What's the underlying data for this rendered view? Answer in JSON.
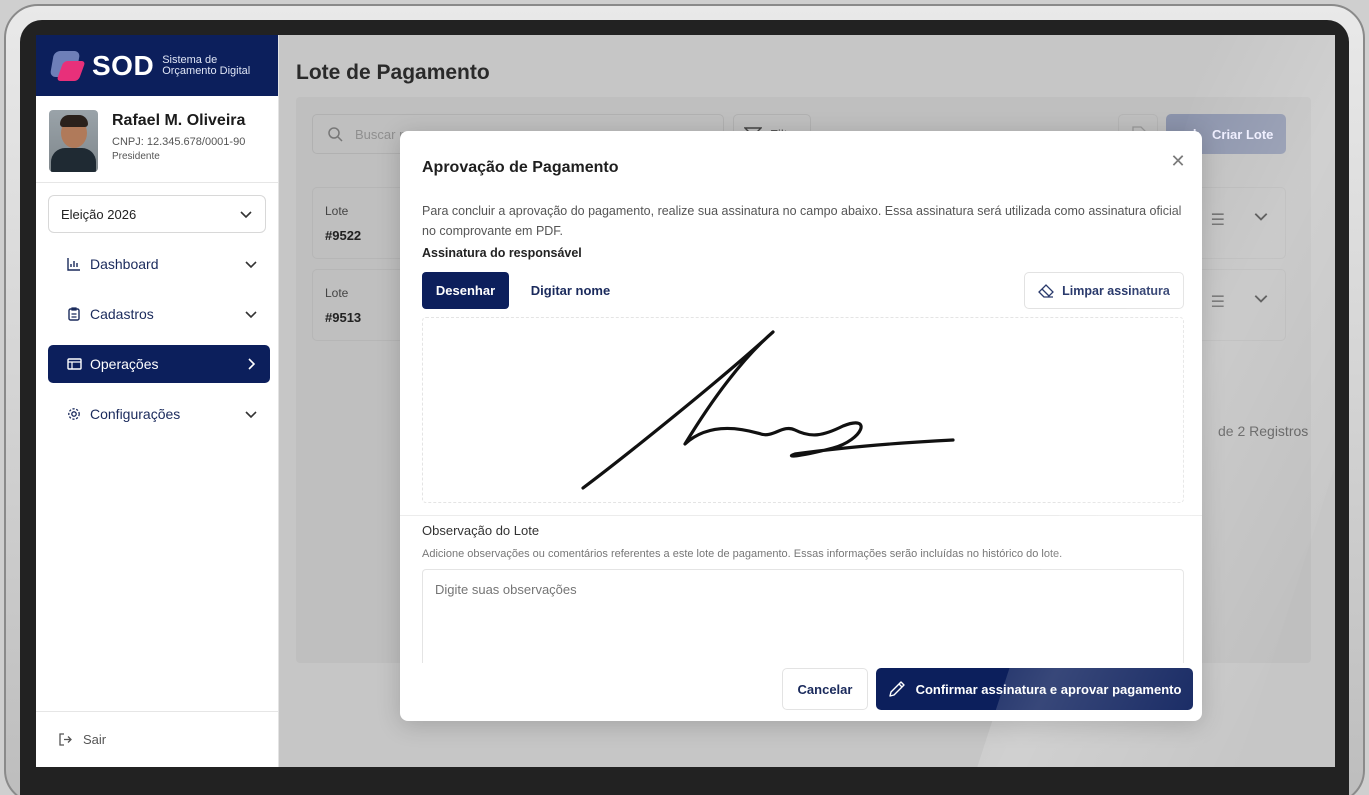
{
  "brand": {
    "name": "SOD",
    "subtitle_line1": "Sistema de",
    "subtitle_line2": "Orçamento Digital"
  },
  "profile": {
    "name": "Rafael M. Oliveira",
    "cnpj": "CNPJ: 12.345.678/0001-90",
    "role": "Presidente"
  },
  "election_select": {
    "value": "Eleição 2026"
  },
  "sidebar": {
    "items": [
      {
        "label": "Dashboard",
        "icon": "bar-chart-icon",
        "active": false
      },
      {
        "label": "Cadastros",
        "icon": "clipboard-icon",
        "active": false
      },
      {
        "label": "Operações",
        "icon": "window-icon",
        "active": true
      },
      {
        "label": "Configurações",
        "icon": "gear-icon",
        "active": false
      }
    ],
    "logout_label": "Sair"
  },
  "page": {
    "title": "Lote de Pagamento",
    "search_placeholder": "Buscar p",
    "filter_label": "Filt",
    "create_label": "Criar Lote",
    "rows": [
      {
        "label": "Lote",
        "number": "#9522"
      },
      {
        "label": "Lote",
        "number": "#9513"
      }
    ],
    "records_text": "de 2 Registros"
  },
  "modal": {
    "title": "Aprovação de Pagamento",
    "description": "Para concluir a aprovação do pagamento, realize sua assinatura no campo abaixo. Essa assinatura será utilizada como assinatura oficial no comprovante em PDF.",
    "signature_label": "Assinatura do responsável",
    "tab_draw": "Desenhar",
    "tab_type": "Digitar nome",
    "clear_label": "Limpar assinatura",
    "observation_label": "Observação do Lote",
    "observation_help": "Adicione observações ou comentários referentes a este lote de pagamento. Essas informações serão incluídas no histórico do lote.",
    "observation_placeholder": "Digite suas observações",
    "cancel_label": "Cancelar",
    "confirm_label": "Confirmar assinatura e aprovar pagamento"
  },
  "colors": {
    "primary": "#0c1f5c",
    "accent": "#e8307a"
  }
}
